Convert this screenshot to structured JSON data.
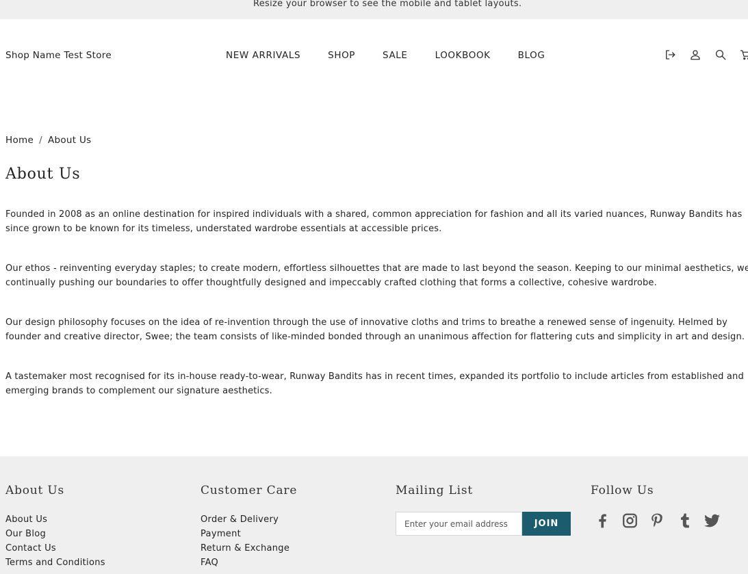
{
  "banner": {
    "text": "Resize your browser to see the mobile and tablet layouts."
  },
  "header": {
    "shop_name": "Shop Name Test Store",
    "nav": [
      "NEW ARRIVALS",
      "SHOP",
      "SALE",
      "LOOKBOOK",
      "BLOG"
    ],
    "icons": [
      "logout-icon",
      "account-icon",
      "search-icon",
      "cart-icon"
    ]
  },
  "breadcrumb": {
    "home": "Home",
    "separator": "/",
    "current": "About Us"
  },
  "page": {
    "title": "About Us",
    "paragraphs": [
      "Founded in 2008 as an online destination for inspired individuals with a shared, common appreciation for fashion and all its varied nuances, Runway Bandits has since grown to be known for its timeless, understated wardrobe essentials at accessible prices.",
      "Our ethos - reinventing everyday staples; to create modern, effortless silhouettes that are made to last beyond the season. Keeping to our minimal aesthetics, we continually pushing our boundaries to offer thoughtfully designed and impeccably crafted clothing that forms a collective, cohesive wardrobe.",
      "Our design philosophy focuses on the idea of re-invention through the use of innovative cloths and trims to breathe a renewed sense of ingenuity. Helmed by founder and creative director, Swee; the team consists of like-minded bonded through an unanimous affection for flattering cuts and simplicity in art and design.",
      "A tastemaker most recognised for its in-house ready-to-wear, Runway Bandits has in recent times, expanded its portfolio to include articles from established and emerging brands to complement our signature aesthetics."
    ]
  },
  "footer": {
    "about": {
      "heading": "About Us",
      "links": [
        "About Us",
        "Our Blog",
        "Contact Us",
        "Terms and Conditions"
      ]
    },
    "care": {
      "heading": "Customer Care",
      "links": [
        "Order & Delivery",
        "Payment",
        "Return & Exchange",
        "FAQ"
      ]
    },
    "mailing": {
      "heading": "Mailing List",
      "placeholder": "Enter your email address",
      "button": "JOIN"
    },
    "follow": {
      "heading": "Follow Us",
      "icons": [
        "facebook-icon",
        "instagram-icon",
        "pinterest-icon",
        "tumblr-icon",
        "twitter-icon"
      ]
    }
  },
  "colors": {
    "accent": "#1b5c6e",
    "banner_bg": "#efefef",
    "footer_bg": "#efefef",
    "text": "#222222"
  }
}
